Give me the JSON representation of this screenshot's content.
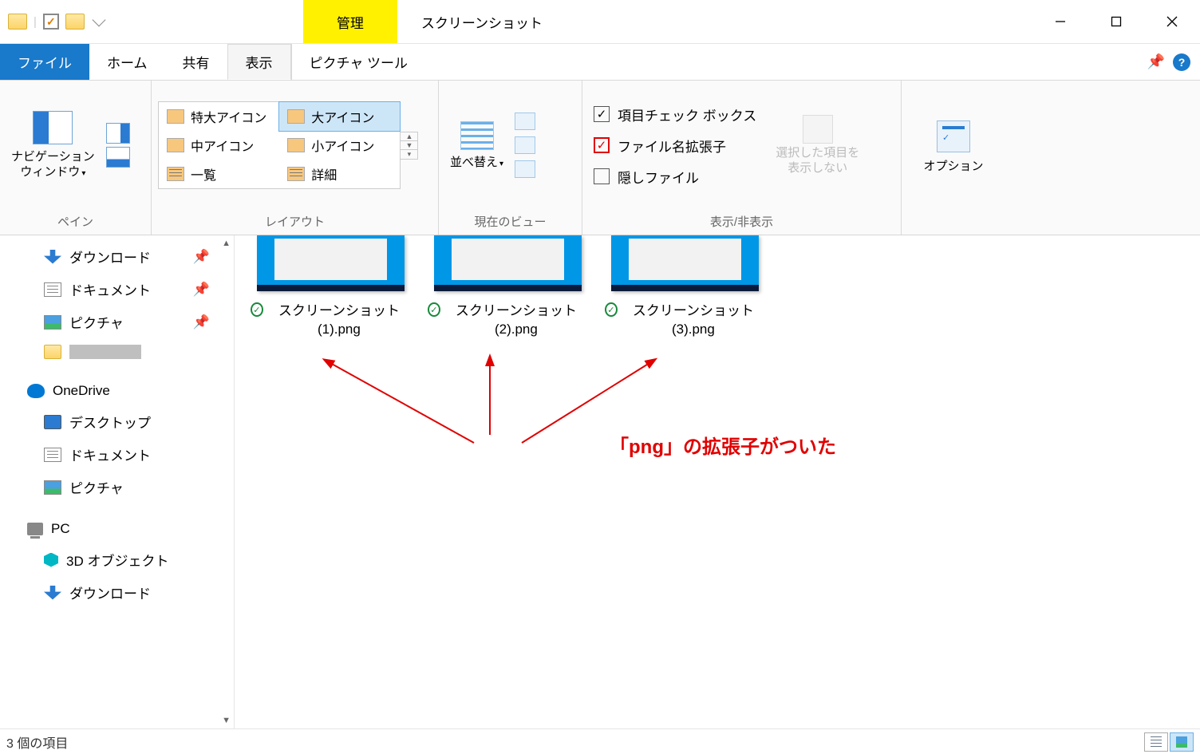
{
  "titlebar": {
    "context_label": "管理",
    "window_title": "スクリーンショット"
  },
  "tabs": {
    "file": "ファイル",
    "home": "ホーム",
    "share": "共有",
    "view": "表示",
    "context_sub": "ピクチャ ツール"
  },
  "ribbon": {
    "pane_group": "ペイン",
    "nav_pane": "ナビゲーション\nウィンドウ",
    "layout_group": "レイアウト",
    "layout": {
      "xlarge": "特大アイコン",
      "large": "大アイコン",
      "medium": "中アイコン",
      "small": "小アイコン",
      "list": "一覧",
      "details": "詳細"
    },
    "currview_group": "現在のビュー",
    "sort": "並べ替え",
    "showhide_group": "表示/非表示",
    "chk_itemcheck": "項目チェック ボックス",
    "chk_ext": "ファイル名拡張子",
    "chk_hidden": "隠しファイル",
    "hide_selected": "選択した項目を\n表示しない",
    "options": "オプション"
  },
  "sidebar": {
    "downloads": "ダウンロード",
    "documents": "ドキュメント",
    "pictures": "ピクチャ",
    "onedrive": "OneDrive",
    "desktop": "デスクトップ",
    "documents2": "ドキュメント",
    "pictures2": "ピクチャ",
    "pc": "PC",
    "objects3d": "3D オブジェクト",
    "downloads2": "ダウンロード"
  },
  "files": [
    {
      "name": "スクリーンショット (1).png"
    },
    {
      "name": "スクリーンショット (2).png"
    },
    {
      "name": "スクリーンショット (3).png"
    }
  ],
  "annotation": "「png」の拡張子がついた",
  "status": "3 個の項目"
}
